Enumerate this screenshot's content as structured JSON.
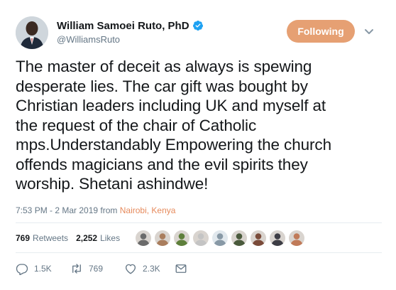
{
  "author": {
    "display_name": "William Samoei Ruto, PhD",
    "handle": "@WilliamsRuto",
    "verified": true
  },
  "follow_button": {
    "label": "Following",
    "color": "#e6a073"
  },
  "tweet": {
    "text": "The master of deceit as always is spewing\ndesperate lies. The car gift was bought by\nChristian leaders including UK and myself at\nthe request of  the chair of Catholic\nmps.Understandably Empowering the church\noffends  magicians and the evil spirits they\nworship. Shetani ashindwe!",
    "time": "7:53 PM - 2 Mar 2019 from ",
    "location": "Nairobi, Kenya"
  },
  "stats": {
    "retweets_count": "769",
    "retweets_label": "Retweets",
    "likes_count": "2,252",
    "likes_label": "Likes"
  },
  "liker_avatars": [
    {
      "icon": "user-avatar",
      "color": "#6b6b6b"
    },
    {
      "icon": "user-avatar",
      "color": "#a97d5d"
    },
    {
      "icon": "user-avatar",
      "color": "#5e7f3b"
    },
    {
      "icon": "user-avatar",
      "color": "#c4c4c4"
    },
    {
      "icon": "default-avatar",
      "color": "#8899a6"
    },
    {
      "icon": "user-avatar",
      "color": "#4a5a3c"
    },
    {
      "icon": "user-avatar",
      "color": "#7a4b3a"
    },
    {
      "icon": "user-avatar",
      "color": "#3d3d45"
    },
    {
      "icon": "user-avatar",
      "color": "#c07a58"
    }
  ],
  "actions": {
    "reply_count": "1.5K",
    "retweet_count": "769",
    "like_count": "2.3K"
  },
  "colors": {
    "accent": "#e6a073",
    "link": "#e68a5c",
    "verified": "#1da1f2",
    "muted": "#657786"
  }
}
